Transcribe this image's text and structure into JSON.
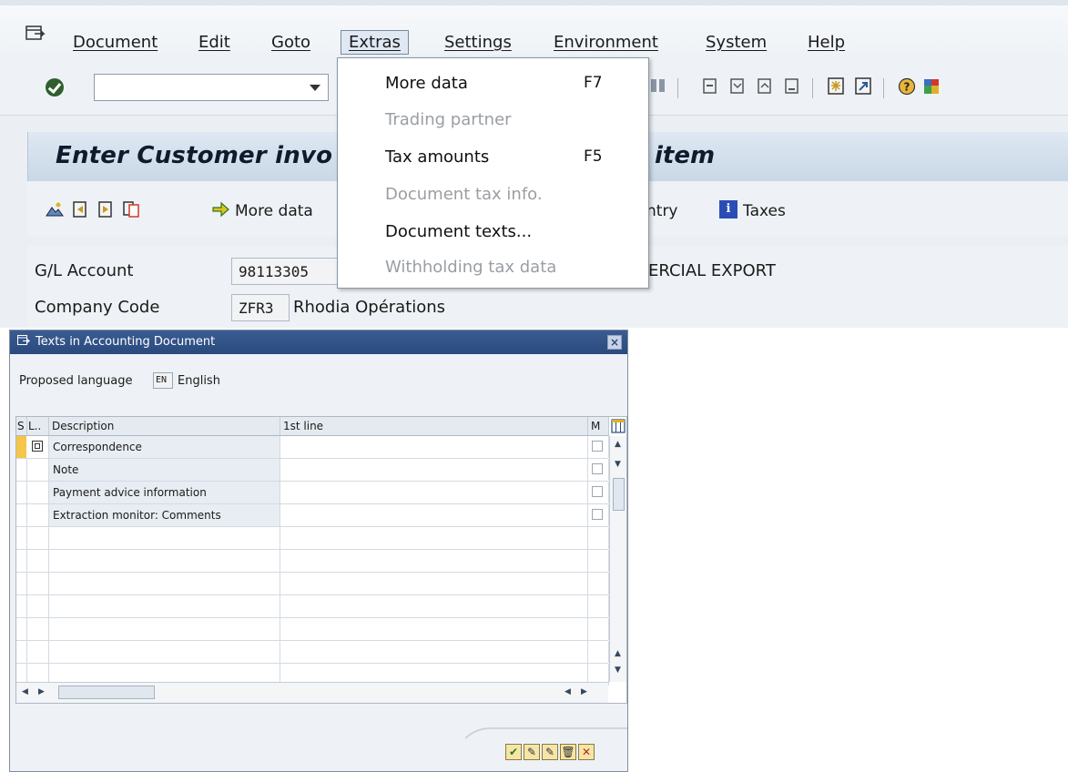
{
  "menubar": {
    "items": [
      "Document",
      "Edit",
      "Goto",
      "Extras",
      "Settings",
      "Environment",
      "System",
      "Help"
    ]
  },
  "extras_menu": {
    "items": [
      {
        "label": "More data",
        "shortcut": "F7",
        "enabled": true
      },
      {
        "label": "Trading partner",
        "shortcut": "",
        "enabled": false
      },
      {
        "label": "Tax amounts",
        "shortcut": "F5",
        "enabled": true
      },
      {
        "label": "Document tax info.",
        "shortcut": "",
        "enabled": false
      },
      {
        "label": "Document texts...",
        "shortcut": "",
        "enabled": true
      },
      {
        "label": "Withholding tax data",
        "shortcut": "",
        "enabled": false
      }
    ]
  },
  "toolbar": {
    "okcode_value": ""
  },
  "title": {
    "left": "Enter Customer invo",
    "right": "item"
  },
  "app_toolbar": {
    "more_data_label": "More data",
    "entry_label": "ntry",
    "taxes_label": "Taxes"
  },
  "fields": {
    "gl_account_label": "G/L Account",
    "gl_account_value": "98113305",
    "gl_account_text": "ERCIAL EXPORT",
    "company_code_label": "Company Code",
    "company_code_value": "ZFR3",
    "company_code_text": "Rhodia Opérations"
  },
  "dialog": {
    "title": "Texts in Accounting Document",
    "proposed_language_label": "Proposed language",
    "language_code": "EN",
    "language_name": "English",
    "columns": [
      "S",
      "L..",
      "Description",
      "1st line",
      "M"
    ],
    "rows": [
      {
        "description": "Correspondence",
        "first_line": ""
      },
      {
        "description": "Note",
        "first_line": ""
      },
      {
        "description": "Payment advice information",
        "first_line": ""
      },
      {
        "description": "Extraction monitor: Comments",
        "first_line": ""
      }
    ],
    "empty_rows": 7
  },
  "colors": {
    "menu_bg": "#eef2f6",
    "title_band": "#c9d7e6",
    "dialog_title": "#2a4a7d",
    "cell_desc_bg": "#e7edf3"
  }
}
